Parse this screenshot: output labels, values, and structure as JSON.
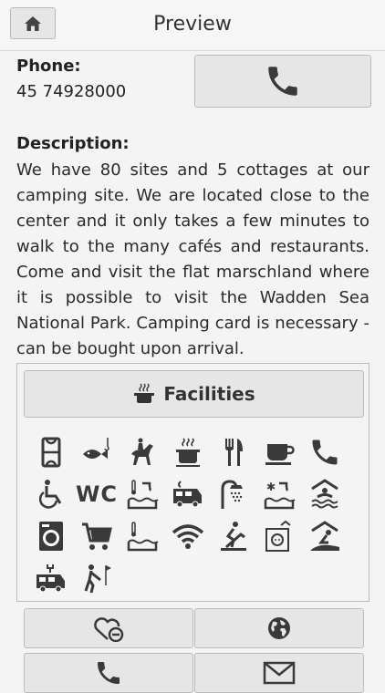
{
  "header": {
    "title": "Preview",
    "home_icon": "home-icon"
  },
  "phone": {
    "label": "Phone:",
    "value": "45 74928000",
    "call_icon": "phone-icon"
  },
  "description": {
    "label": "Description:",
    "text": "We have 80 sites and 5 cottages at our camping site. We are located close to the center and it only takes a few minutes to walk to the many cafés and restaurants. Come and visit the flat marschland where it is possible to visit the Wadden Sea National Park. Camping card is necessary - can be bought upon arrival."
  },
  "facilities": {
    "button_label": "Facilities",
    "button_icon": "cooking-pot-icon",
    "icons": [
      "sports-field-icon",
      "fishing-icon",
      "horse-riding-icon",
      "cooking-icon",
      "restaurant-icon",
      "cafe-icon",
      "telephone-icon",
      "wheelchair-icon",
      "wc-icon",
      "heated-pool-icon",
      "motorhome-service-icon",
      "shower-icon",
      "cold-pool-icon",
      "indoor-pool-icon",
      "washing-machine-icon",
      "shopping-cart-icon",
      "thermometer-pool-icon",
      "wifi-icon",
      "playground-icon",
      "power-outlet-icon",
      "beach-icon",
      "motorhome-electric-icon",
      "golf-icon"
    ],
    "wc_text": "WC"
  },
  "bottom_buttons": [
    {
      "icon": "favorite-remove-icon"
    },
    {
      "icon": "globe-icon"
    },
    {
      "icon": "phone-icon"
    },
    {
      "icon": "mail-icon"
    }
  ],
  "colors": {
    "icon": "#3a3a3a",
    "button_bg": "#e6e6e6",
    "page_bg": "#f4f4f4"
  }
}
